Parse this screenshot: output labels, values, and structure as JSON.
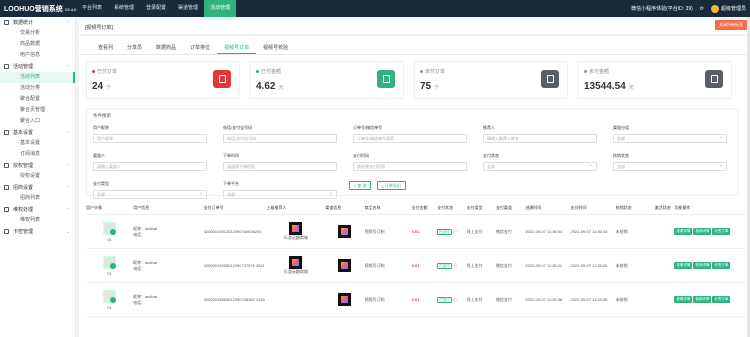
{
  "app": {
    "name": "LOOHUO营销系统",
    "version": "V3.4.0"
  },
  "nav": [
    "平台列表",
    "系统管理",
    "登录配置",
    "渠道管理",
    "活动管理"
  ],
  "nav_active": 4,
  "topright": {
    "mini_program": "微信小程序体验(平台ID: 39)",
    "username": "超级管理员"
  },
  "sidebar": [
    {
      "type": "group",
      "label": "数据统计",
      "expanded": true
    },
    {
      "type": "item",
      "label": "交易分析"
    },
    {
      "type": "item",
      "label": "商品数据"
    },
    {
      "type": "item",
      "label": "用户信息"
    },
    {
      "type": "group",
      "label": "活动管理",
      "expanded": true
    },
    {
      "type": "item",
      "label": "活动列表",
      "active": true
    },
    {
      "type": "item",
      "label": "活动分类"
    },
    {
      "type": "item",
      "label": "聚合配置"
    },
    {
      "type": "item",
      "label": "聚合页管理"
    },
    {
      "type": "item",
      "label": "聚合入口"
    },
    {
      "type": "group",
      "label": "基本设置",
      "expanded": true
    },
    {
      "type": "item",
      "label": "基本设置"
    },
    {
      "type": "item",
      "label": "订阅消息"
    },
    {
      "type": "group",
      "label": "授权管理",
      "expanded": true
    },
    {
      "type": "item",
      "label": "授权设置"
    },
    {
      "type": "group",
      "label": "招商设置",
      "expanded": true
    },
    {
      "type": "item",
      "label": "招商列表"
    },
    {
      "type": "group",
      "label": "维权处理",
      "expanded": true
    },
    {
      "type": "item",
      "label": "维权列表"
    },
    {
      "type": "group",
      "label": "卡密管理",
      "expanded": false
    }
  ],
  "breadcrumb": "[视频号订单]",
  "close_all": "关闭所有标签",
  "tabs": [
    "查看列",
    "分享员",
    "数据商品",
    "订单排位",
    "视频号订单",
    "视频号校验"
  ],
  "tab_active": 4,
  "cards": [
    {
      "label": "已付订单",
      "value": "24",
      "unit": "个",
      "dot_color": "#e2383a",
      "icon": "clipboard-icon",
      "icon_color": "#e2383a"
    },
    {
      "label": "已付金额",
      "value": "4.62",
      "unit": "元",
      "dot_color": "#2fb37f",
      "icon": "money-icon",
      "icon_color": "#2fb37f"
    },
    {
      "label": "未付订单",
      "value": "75",
      "unit": "个",
      "dot_color": "#909399",
      "icon": "document-icon",
      "icon_color": "#5a5e66"
    },
    {
      "label": "未付金额",
      "value": "13544.54",
      "unit": "元",
      "dot_color": "#909399",
      "icon": "wallet-icon",
      "icon_color": "#5a5e66"
    }
  ],
  "filter": {
    "title": "条件搜索",
    "fields": [
      {
        "label": "用户昵称",
        "placeholder": "用户昵称",
        "select": false
      },
      {
        "label": "电话/支付宝号码",
        "placeholder": "电话/支付宝号码",
        "select": false
      },
      {
        "label": "订单号/微信单号",
        "placeholder": "订单号/微信单号搜索",
        "select": false
      },
      {
        "label": "推荐人",
        "placeholder": "请输入推荐人姓名",
        "select": false
      },
      {
        "label": "渠道分组",
        "placeholder": "全部",
        "select": true
      },
      {
        "label": "渠道人",
        "placeholder": "请输入渠道人",
        "select": false
      },
      {
        "label": "下单时间",
        "placeholder": "请选择下单时间",
        "select": false
      },
      {
        "label": "支付时间",
        "placeholder": "请选择支付时间",
        "select": false
      },
      {
        "label": "支付状态",
        "placeholder": "全部",
        "select": true
      },
      {
        "label": "核销状态",
        "placeholder": "全部",
        "select": true
      },
      {
        "label": "支付类型",
        "placeholder": "全部",
        "select": true
      },
      {
        "label": "下单平台",
        "placeholder": "全部",
        "select": true
      }
    ],
    "search_btn": "查 询",
    "export_btn": "订单导出"
  },
  "table": {
    "headers": [
      "用户头像",
      "用户信息",
      "支付订单号",
      "上级推荐人",
      "渠道信息",
      "商品名称",
      "支付金额",
      "支付状态",
      "支付类型",
      "支付渠道",
      "创建时间",
      "支付时间",
      "核销状态",
      "激活状态",
      "功能操作"
    ],
    "rows": [
      {
        "avatar_num": "01",
        "nick": "昵称：axdhat",
        "phone": "电话：",
        "order": "42000015912012090780006291",
        "ref": "乐游云趣商城",
        "product": "视频号订制",
        "amount": "0.01",
        "status": "已支付",
        "ptype": "线上支付",
        "channel": "微信支付",
        "created": "2022-09-07 11:35:54",
        "paid": "2022-09-07 11:36:03",
        "verify": "未核销",
        "activate": ""
      },
      {
        "avatar_num": "01",
        "nick": "昵称：axdhat",
        "phone": "电话：",
        "order": "42000015928012090737979 4521",
        "ref": "乐游云趣商城",
        "product": "视频号订制",
        "amount": "0.01",
        "status": "已支付",
        "ptype": "线上支付",
        "channel": "微信支付",
        "created": "2022-09-07 11:35:22",
        "paid": "2022-09-07 11:35:26",
        "verify": "未核销",
        "activate": ""
      },
      {
        "avatar_num": "01",
        "nick": "昵称：axdhat",
        "phone": "电话：",
        "order": "42000015854012090796182 2145",
        "ref": "",
        "product": "视频号订制",
        "amount": "0.01",
        "status": "已支付",
        "ptype": "线上支付",
        "channel": "微信支付",
        "created": "2022-09-07 11:26:38",
        "paid": "2022-09-07 11:26:45",
        "verify": "未核销",
        "activate": ""
      }
    ],
    "actions": [
      "查看详情",
      "核销详情",
      "补签订单"
    ]
  }
}
